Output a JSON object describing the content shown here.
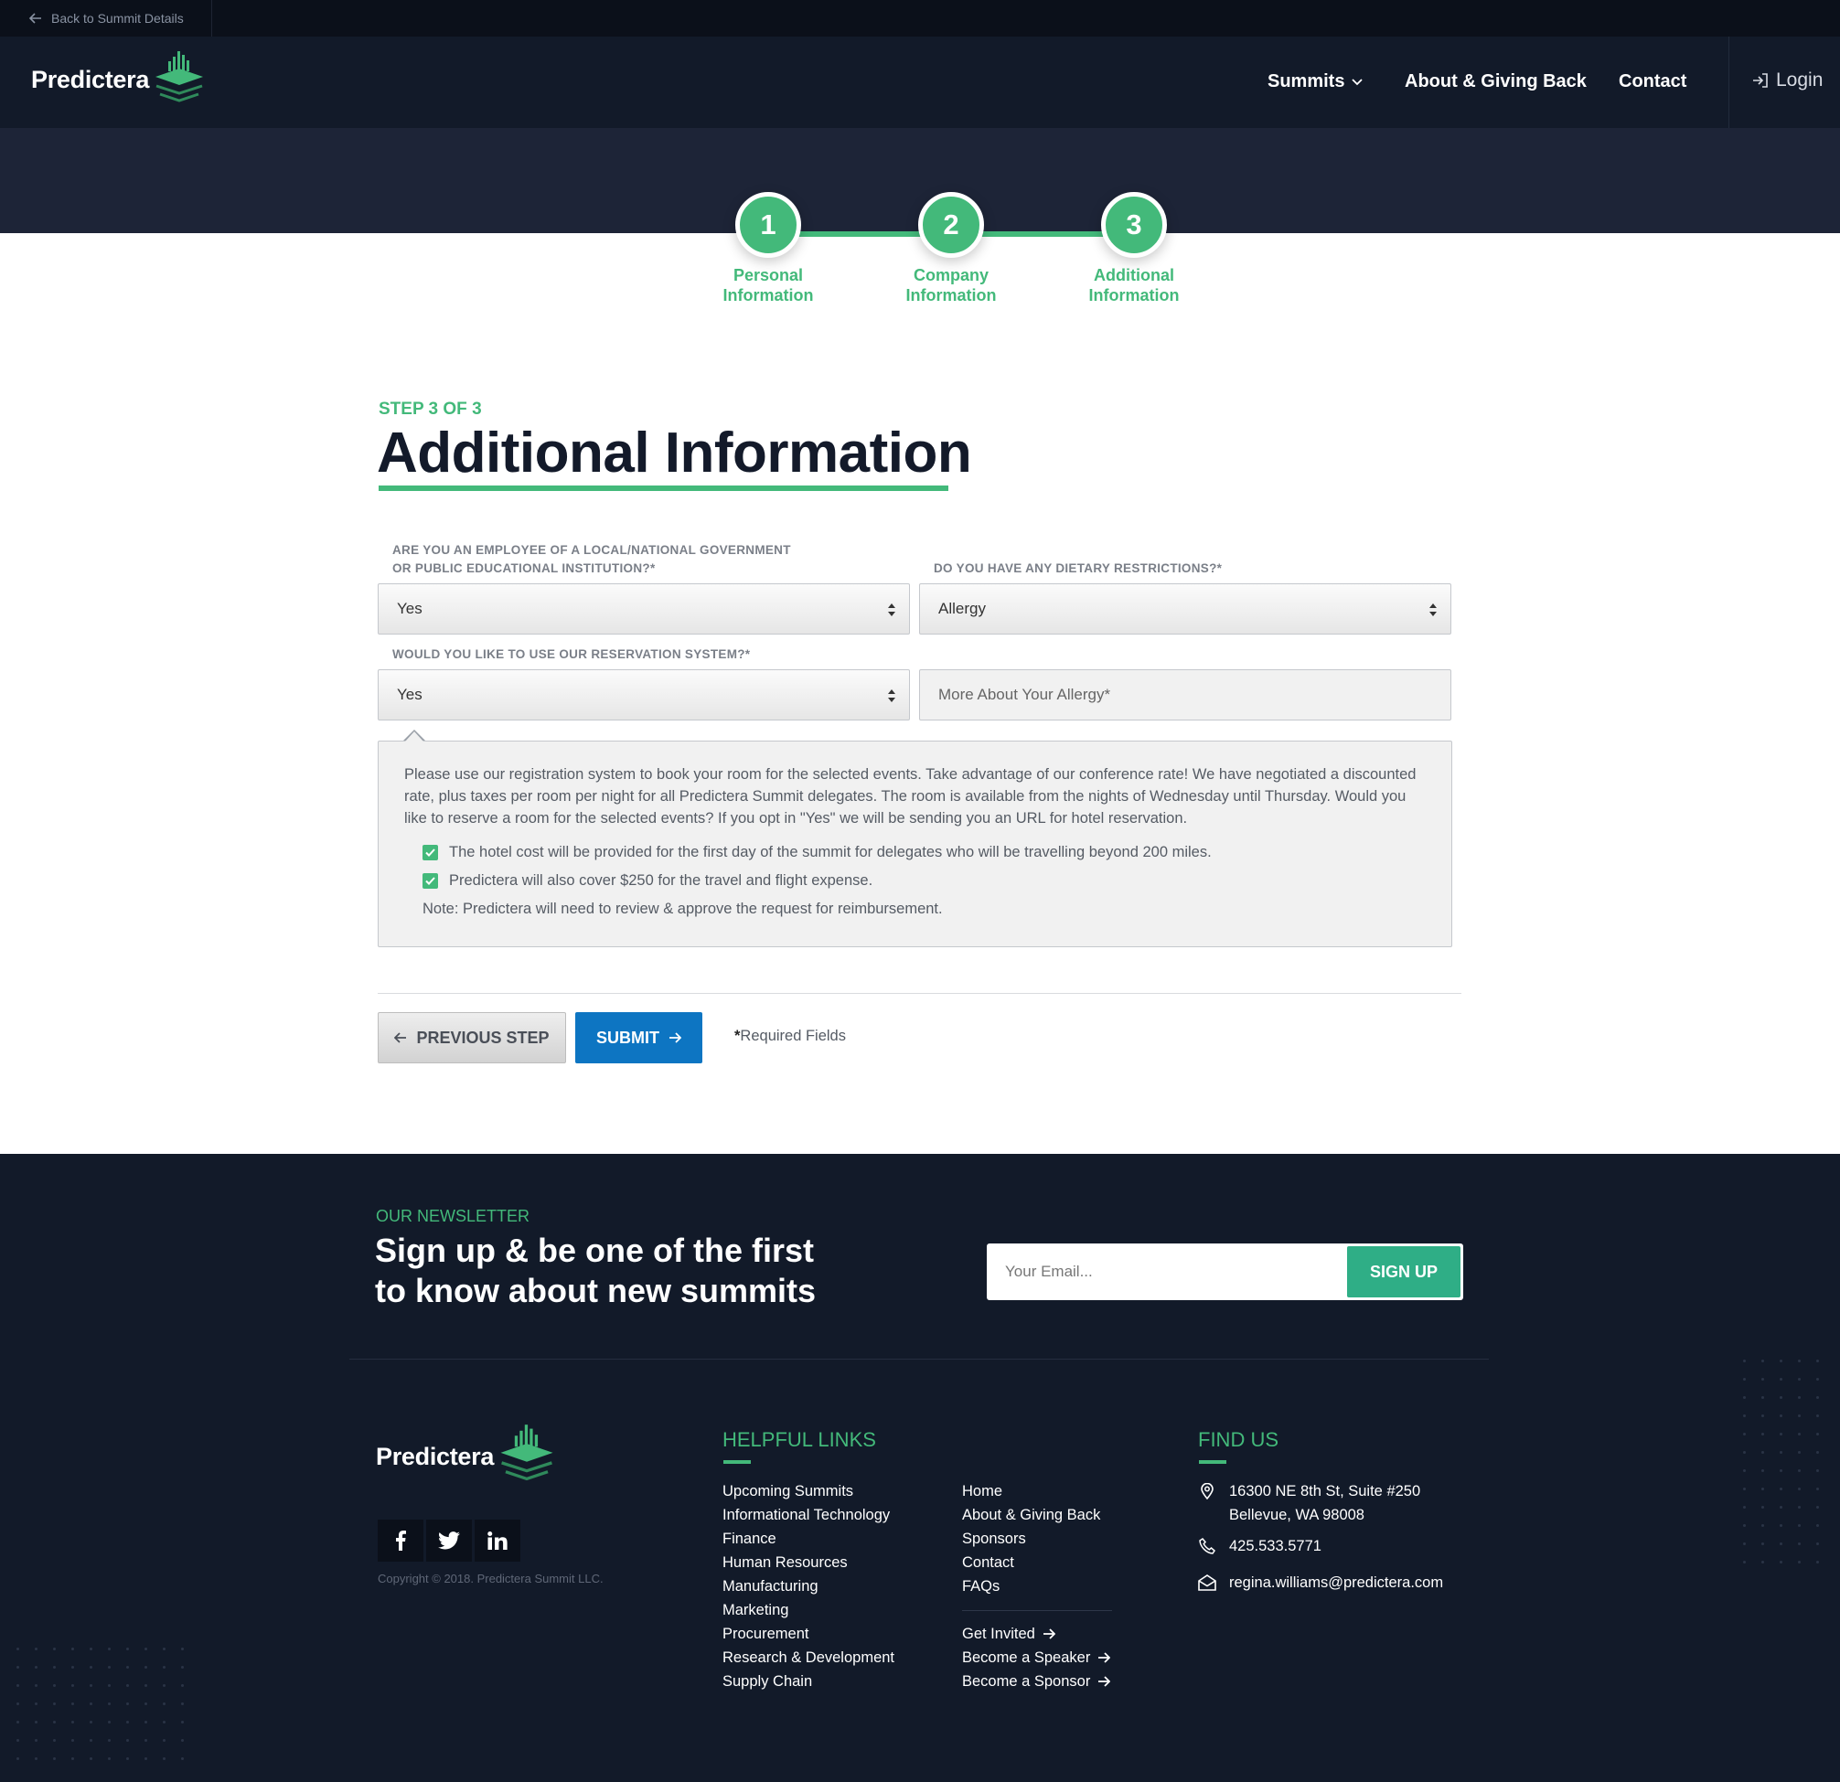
{
  "topbar": {
    "back_label": "Back to Summit Details"
  },
  "brand": {
    "name": "Predictera"
  },
  "nav": {
    "items": [
      {
        "label": "Summits",
        "has_dropdown": true
      },
      {
        "label": "About & Giving Back"
      },
      {
        "label": "Contact"
      }
    ],
    "login_label": "Login"
  },
  "stepper": {
    "steps": [
      {
        "number": "1",
        "label_line1": "Personal",
        "label_line2": "Information"
      },
      {
        "number": "2",
        "label_line1": "Company",
        "label_line2": "Information"
      },
      {
        "number": "3",
        "label_line1": "Additional",
        "label_line2": "Information"
      }
    ]
  },
  "form": {
    "step_counter": "STEP 3 OF 3",
    "title": "Additional Information",
    "government_label_line1": "ARE YOU AN EMPLOYEE OF A LOCAL/NATIONAL GOVERNMENT",
    "government_label_line2": "OR PUBLIC EDUCATIONAL INSTITUTION?*",
    "government_value": "Yes",
    "dietary_label": "DO YOU HAVE ANY DIETARY RESTRICTIONS?*",
    "dietary_value": "Allergy",
    "reservation_label": "WOULD YOU LIKE TO USE OUR RESERVATION SYSTEM?*",
    "reservation_value": "Yes",
    "allergy_placeholder": "More About Your Allergy*",
    "info_text": "Please use our registration system to book your room for the selected events. Take advantage of our conference rate! We have negotiated a discounted rate, plus taxes per room per night for all Predictera Summit delegates. The room is available from the nights of Wednesday until Thursday. Would you like to reserve a room for the selected events? If you opt in \"Yes\" we will be sending you an URL for hotel reservation.",
    "check_1": "The hotel cost will be provided for the first day of the summit for delegates who will be travelling beyond 200 miles.",
    "check_2": "Predictera will also cover $250 for the travel and flight expense.",
    "note": "Note: Predictera will need to review & approve the request for reimbursement.",
    "prev_label": "PREVIOUS STEP",
    "submit_label": "SUBMIT",
    "required_star": "*",
    "required_text": "Required Fields"
  },
  "newsletter": {
    "eyebrow": "OUR NEWSLETTER",
    "heading_line1": "Sign up & be one of the first",
    "heading_line2": "to know about new summits",
    "email_placeholder": "Your Email...",
    "button_label": "SIGN UP"
  },
  "footer": {
    "copyright": "Copyright © 2018. Predictera Summit LLC.",
    "social": [
      "facebook-icon",
      "twitter-icon",
      "linkedin-icon"
    ],
    "helpful_title": "HELPFUL LINKS",
    "links_col1": [
      "Upcoming Summits",
      "Informational Technology",
      "Finance",
      "Human Resources",
      "Manufacturing",
      "Marketing",
      "Procurement",
      "Research & Development",
      "Supply Chain"
    ],
    "links_col2": [
      "Home",
      "About & Giving Back",
      "Sponsors",
      "Contact",
      "FAQs"
    ],
    "links_col2_cta": [
      "Get Invited",
      "Become a Speaker",
      "Become a Sponsor"
    ],
    "find_title": "FIND US",
    "address_line1": "16300 NE 8th St, Suite #250",
    "address_line2": "Bellevue, WA 98008",
    "phone": "425.533.5771",
    "email": "regina.williams@predictera.com"
  },
  "colors": {
    "accent": "#43b97a",
    "navy": "#121a29",
    "submit_blue": "#0d75c2",
    "signup_green": "#2fae86"
  }
}
